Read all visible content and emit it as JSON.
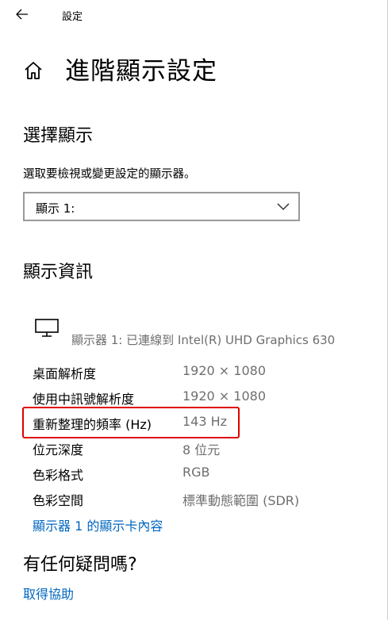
{
  "window": {
    "title": "設定"
  },
  "page": {
    "title": "進階顯示設定"
  },
  "select_display": {
    "heading": "選擇顯示",
    "description": "選取要檢視或變更設定的顯示器。",
    "dropdown_value": "顯示 1:"
  },
  "display_info": {
    "heading": "顯示資訊",
    "monitor_description": "顯示器 1: 已連線到 Intel(R) UHD Graphics 630",
    "rows": [
      {
        "label": "桌面解析度",
        "value": "1920 × 1080"
      },
      {
        "label": "使用中訊號解析度",
        "value": "1920 × 1080"
      },
      {
        "label": "重新整理的頻率 (Hz)",
        "value": "143 Hz"
      },
      {
        "label": "位元深度",
        "value": "8 位元"
      },
      {
        "label": "色彩格式",
        "value": "RGB"
      },
      {
        "label": "色彩空間",
        "value": "標準動態範圍 (SDR)"
      }
    ],
    "adapter_link": "顯示器 1 的顯示卡內容"
  },
  "help": {
    "heading": "有任何疑問嗎?",
    "link": "取得協助"
  },
  "colors": {
    "link": "#0067c0",
    "highlight": "#e00000",
    "secondary_text": "#6e6e6e"
  }
}
